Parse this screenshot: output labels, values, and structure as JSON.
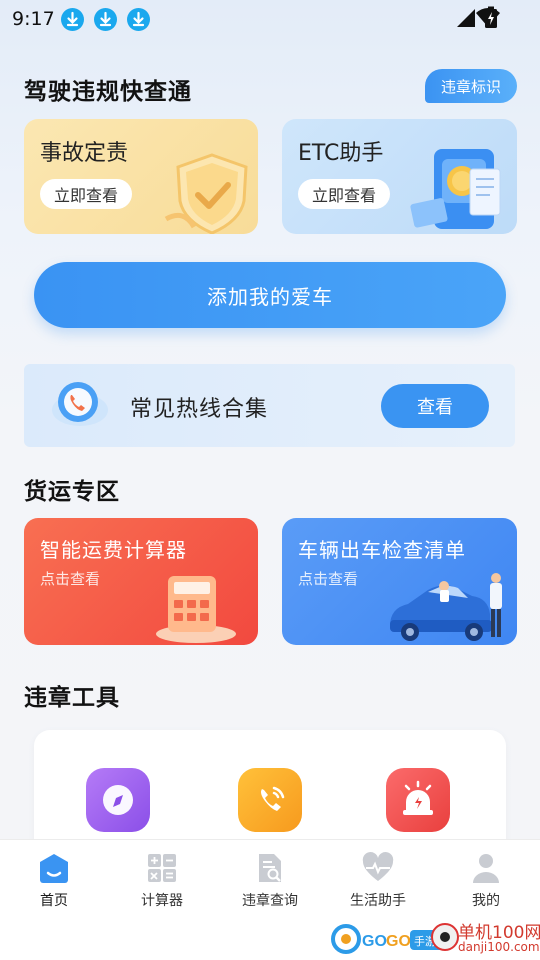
{
  "status_bar": {
    "time": "9:17"
  },
  "section1": {
    "title": "驾驶违规快查通",
    "tag_button": "违章标识"
  },
  "cards": {
    "accident": {
      "title": "事故定责",
      "button": "立即查看"
    },
    "etc": {
      "title": "ETC助手",
      "button": "立即查看"
    }
  },
  "add_car": {
    "label": "添加我的爱车"
  },
  "hotline": {
    "label": "常见热线合集",
    "button": "查看"
  },
  "freight": {
    "title": "货运专区",
    "calc": {
      "title": "智能运费计算器",
      "subtitle": "点击查看"
    },
    "checklist": {
      "title": "车辆出车检查清单",
      "subtitle": "点击查看"
    }
  },
  "tools": {
    "title": "违章工具"
  },
  "nav": {
    "home": "首页",
    "calculator": "计算器",
    "violation": "违章查询",
    "life": "生活助手",
    "mine": "我的"
  },
  "watermark": {
    "brand": "GOGO手游网",
    "site_cn": "单机100网",
    "site_url": "danji100.com"
  },
  "colors": {
    "accent": "#3a94f2",
    "freight_red": "#f5574a",
    "freight_blue": "#4a8ff5"
  }
}
